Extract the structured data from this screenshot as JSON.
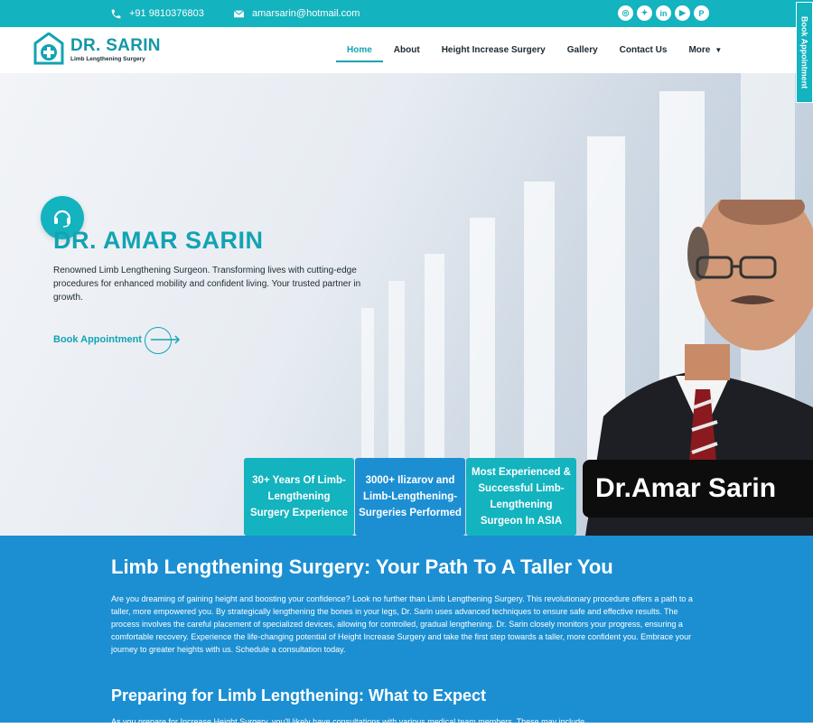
{
  "topbar": {
    "phone": "+91 9810376803",
    "email": "amarsarin@hotmail.com",
    "socials": [
      "instagram-icon",
      "twitter-icon",
      "linkedin-icon",
      "youtube-icon",
      "pinterest-icon"
    ]
  },
  "header": {
    "logo_title": "DR. SARIN",
    "logo_subtitle": "Limb Lengthening Surgery",
    "nav": [
      {
        "label": "Home",
        "active": true
      },
      {
        "label": "About"
      },
      {
        "label": "Height Increase Surgery"
      },
      {
        "label": "Gallery"
      },
      {
        "label": "Contact Us"
      },
      {
        "label": "More"
      }
    ]
  },
  "side_tab": "Book Appointment",
  "hero": {
    "title": "DR. AMAR SARIN",
    "description": "Renowned Limb Lengthening Surgeon. Transforming lives with cutting-edge procedures for enhanced mobility and confident living. Your trusted partner in growth.",
    "cta": "Book Appointment",
    "name_plate": "Dr.Amar Sarin",
    "stats": [
      "30+ Years Of Limb-Lengthening Surgery Experience",
      "3000+ Ilizarov and Limb-Lengthening-Surgeries Performed",
      "Most Experienced & Successful Limb-Lengthening Surgeon In ASIA"
    ]
  },
  "content": {
    "heading": "Limb Lengthening Surgery: Your Path To A Taller You",
    "paragraph": "Are you dreaming of gaining height and boosting your confidence? Look no further than Limb Lengthening Surgery. This revolutionary procedure offers a path to a taller, more empowered you. By strategically lengthening the bones in your legs, Dr. Sarin uses advanced techniques to ensure safe and effective results. The process involves the careful placement of specialized devices, allowing for controlled, gradual lengthening. Dr. Sarin closely monitors your progress, ensuring a comfortable recovery. Experience the life-changing potential of Height Increase Surgery and take the first step towards a taller, more confident you. Embrace your journey to greater heights with us. Schedule a consultation today.",
    "subheading": "Preparing for Limb Lengthening: What to Expect",
    "paragraph2": "As you prepare for Increase Height Surgery, you'll likely have consultations with various medical team members. These may include"
  },
  "colors": {
    "teal": "#13b3bf",
    "blue": "#1c8fd2",
    "dark": "#1b2a33"
  }
}
